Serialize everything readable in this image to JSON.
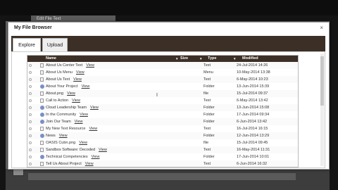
{
  "background": {
    "tab_title": "Edit File Text"
  },
  "dialog": {
    "title": "My File Browser",
    "close_glyph": "×",
    "tabs": [
      {
        "label": "Explore"
      },
      {
        "label": "Upload"
      }
    ]
  },
  "grid": {
    "columns": {
      "name": "Name",
      "size": "Size",
      "type": "Type",
      "modified": "Modified"
    },
    "view_label": "View",
    "rows": [
      {
        "name": "About Us Center Text",
        "type": "Text",
        "modified": "24-Jul-2014 14:26",
        "icon": "file"
      },
      {
        "name": "About Us Menu",
        "type": "Menu",
        "modified": "10-May-2014 13:38",
        "icon": "menu"
      },
      {
        "name": "About Us Text",
        "type": "Text",
        "modified": "6-May-2014 10:23",
        "icon": "file"
      },
      {
        "name": "About Your Project",
        "type": "Folder",
        "modified": "13-Jun-2014 15:39",
        "icon": "folder"
      },
      {
        "name": "About.png",
        "type": "file",
        "modified": "15-Jul-2014 09:37",
        "icon": "file"
      },
      {
        "name": "Call to Action",
        "type": "Text",
        "modified": "6-May-2014 13:42",
        "icon": "file"
      },
      {
        "name": "Cloud Leadership Team",
        "type": "Folder",
        "modified": "13-Jun-2014 15:08",
        "icon": "folder"
      },
      {
        "name": "In the Community",
        "type": "Folder",
        "modified": "17-Jun-2014 09:34",
        "icon": "folder"
      },
      {
        "name": "Join Our Team",
        "type": "Folder",
        "modified": "6-Jun-2014 13:42",
        "icon": "folder"
      },
      {
        "name": "My New Text Resource",
        "type": "Text",
        "modified": "16-Jul-2014 16:15",
        "icon": "file"
      },
      {
        "name": "News",
        "type": "Folder",
        "modified": "12-Jun-2014 13:29",
        "icon": "folder"
      },
      {
        "name": "OASIS Cubn.png",
        "type": "file",
        "modified": "15-Jul-2014 09:45",
        "icon": "file"
      },
      {
        "name": "Sandbox Software: Decoded",
        "type": "Text",
        "modified": "16-May-2014 11:31",
        "icon": "file"
      },
      {
        "name": "Technical Competencies",
        "type": "Folder",
        "modified": "17-Jun-2014 10:01",
        "icon": "folder"
      },
      {
        "name": "Tell Us About Project",
        "type": "Text",
        "modified": "6-Jun-2014 16:32",
        "icon": "file"
      }
    ]
  }
}
